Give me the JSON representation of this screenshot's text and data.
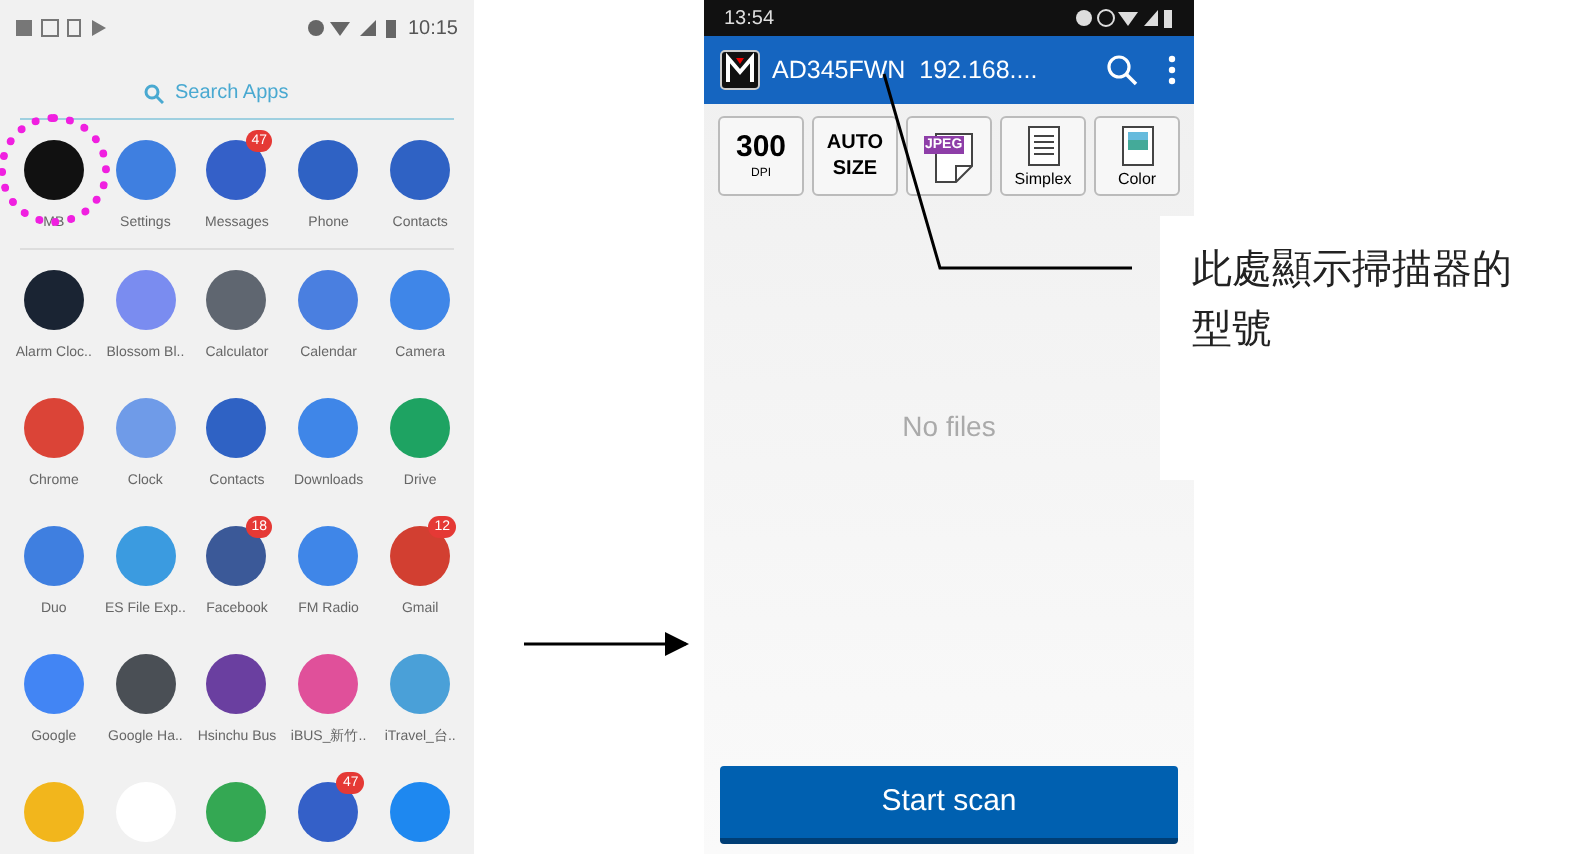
{
  "launcher": {
    "status_bar": {
      "time": "10:15"
    },
    "search": {
      "placeholder": "Search Apps"
    },
    "rows": [
      [
        {
          "label": "MB",
          "color": "#111111",
          "highlighted": true
        },
        {
          "label": "Settings",
          "color": "#3f7fe0"
        },
        {
          "label": "Messages",
          "color": "#3460c8",
          "badge": "47"
        },
        {
          "label": "Phone",
          "color": "#2f62c4"
        },
        {
          "label": "Contacts",
          "color": "#2f62c4"
        }
      ],
      [
        {
          "label": "Alarm Cloc..",
          "color": "#1a2433"
        },
        {
          "label": "Blossom Bl..",
          "color": "#7a8cf0"
        },
        {
          "label": "Calculator",
          "color": "#5f6670"
        },
        {
          "label": "Calendar",
          "color": "#4a7fe0"
        },
        {
          "label": "Camera",
          "color": "#3f86e8"
        }
      ],
      [
        {
          "label": "Chrome",
          "color": "#db4437"
        },
        {
          "label": "Clock",
          "color": "#6f9be8"
        },
        {
          "label": "Contacts",
          "color": "#2f62c4"
        },
        {
          "label": "Downloads",
          "color": "#3f86e8"
        },
        {
          "label": "Drive",
          "color": "#1ea362"
        }
      ],
      [
        {
          "label": "Duo",
          "color": "#3f7fe0"
        },
        {
          "label": "ES File Exp..",
          "color": "#3b9be0"
        },
        {
          "label": "Facebook",
          "color": "#3b5998",
          "badge": "18"
        },
        {
          "label": "FM Radio",
          "color": "#3f86e8"
        },
        {
          "label": "Gmail",
          "color": "#d23f31",
          "badge": "12"
        }
      ],
      [
        {
          "label": "Google",
          "color": "#4285f4"
        },
        {
          "label": "Google Ha..",
          "color": "#4a4f55"
        },
        {
          "label": "Hsinchu Bus",
          "color": "#6a3fa0"
        },
        {
          "label": "iBUS_新竹..",
          "color": "#e0509a"
        },
        {
          "label": "iTravel_台..",
          "color": "#4aa0d8"
        }
      ],
      [
        {
          "color": "#f2b61c"
        },
        {
          "color": "#ffffff"
        },
        {
          "color": "#34a853"
        },
        {
          "color": "#3460c8",
          "badge": "47"
        },
        {
          "color": "#1e88f0"
        }
      ]
    ]
  },
  "scanner": {
    "status_bar": {
      "time": "13:54"
    },
    "app_bar": {
      "title": "AD345FWN  192.168...."
    },
    "options": [
      {
        "kind": "value",
        "value": "300",
        "unit": "DPI"
      },
      {
        "kind": "value",
        "value": "AUTO",
        "unit": "SIZE"
      },
      {
        "kind": "format",
        "value": "JPEG"
      },
      {
        "kind": "side",
        "label": "Simplex"
      },
      {
        "kind": "color",
        "label": "Color"
      }
    ],
    "empty_text": "No files",
    "start_button": "Start scan"
  },
  "callout": "此處顯示掃描器的型號"
}
